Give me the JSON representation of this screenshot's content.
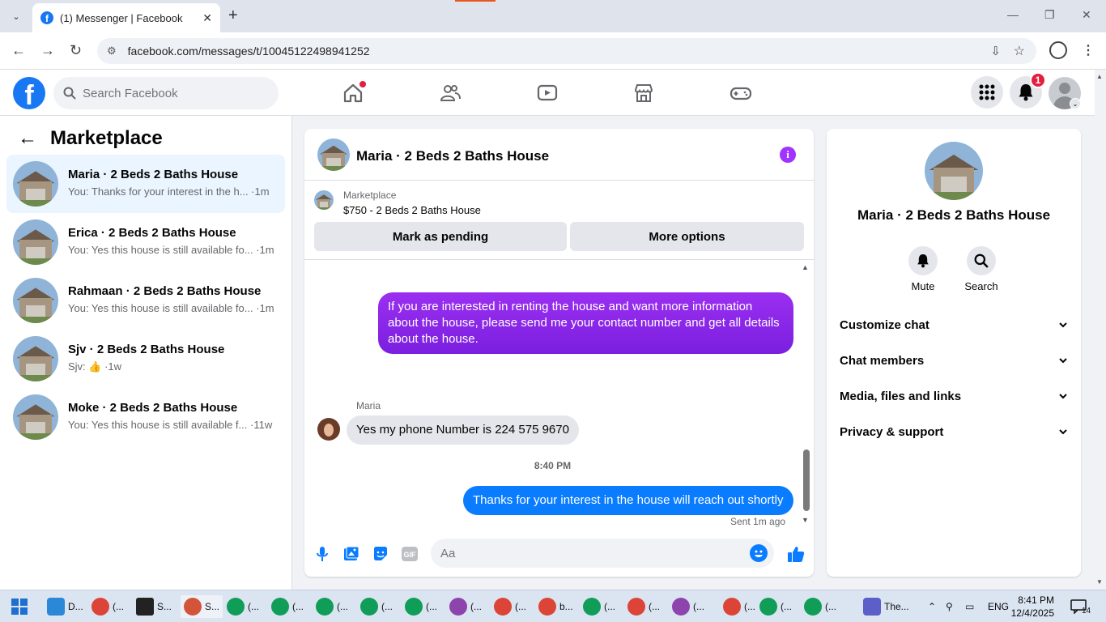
{
  "browser": {
    "tab_title": "(1) Messenger | Facebook",
    "url": "facebook.com/messages/t/10045122498941252"
  },
  "fb": {
    "search_placeholder": "Search Facebook",
    "notification_count": "1"
  },
  "left": {
    "title": "Marketplace",
    "conversations": [
      {
        "name": "Maria · 2 Beds 2 Baths House",
        "snippet": "You: Thanks for your interest in the h... ·1m"
      },
      {
        "name": "Erica · 2 Beds 2 Baths House",
        "snippet": "You: Yes this house is still available fo... ·1m"
      },
      {
        "name": "Rahmaan · 2 Beds 2 Baths House",
        "snippet": "You: Yes this house is still available fo... ·1m"
      },
      {
        "name": "Sjv · 2 Beds 2 Baths House",
        "snippet": "Sjv: 👍 ·1w"
      },
      {
        "name": "Moke · 2 Beds 2 Baths House",
        "snippet": "You: Yes this house is still available f... ·11w"
      }
    ]
  },
  "chat": {
    "title": "Maria · 2 Beds 2 Baths House",
    "marketplace_label": "Marketplace",
    "listing": "$750 - 2 Beds 2 Baths House",
    "mark_pending": "Mark as pending",
    "more_options": "More options",
    "messages": {
      "out1": "If you are interested in renting the house and want more information about the house, please send me your contact number and get all details about the house.",
      "sender": "Maria",
      "in1": "Yes  my phone Number is  224  575 9670",
      "time": "8:40 PM",
      "out2": "Thanks for your interest in the house will reach out shortly",
      "sent_status": "Sent 1m ago"
    },
    "composer_placeholder": "Aa"
  },
  "right": {
    "name": "Maria · 2 Beds 2 Baths House",
    "mute": "Mute",
    "search": "Search",
    "sections": [
      "Customize chat",
      "Chat members",
      "Media, files and links",
      "Privacy & support"
    ]
  },
  "taskbar": {
    "items": [
      "D...",
      "(...",
      "S...",
      "S...",
      "(...",
      "(...",
      "(...",
      "(...",
      "(...",
      "(...",
      "(...",
      "b...",
      "(...",
      "(...",
      "(...",
      "(...",
      "(...",
      "(...",
      "The..."
    ],
    "lang": "ENG",
    "time": "8:41 PM",
    "date": "12/4/2025",
    "notif_count": "14"
  },
  "colors": {
    "fb_blue": "#1877f2",
    "bubble_purple": "#8a2be2",
    "bubble_blue": "#0a7cff",
    "badge_red": "#e41e3f"
  }
}
